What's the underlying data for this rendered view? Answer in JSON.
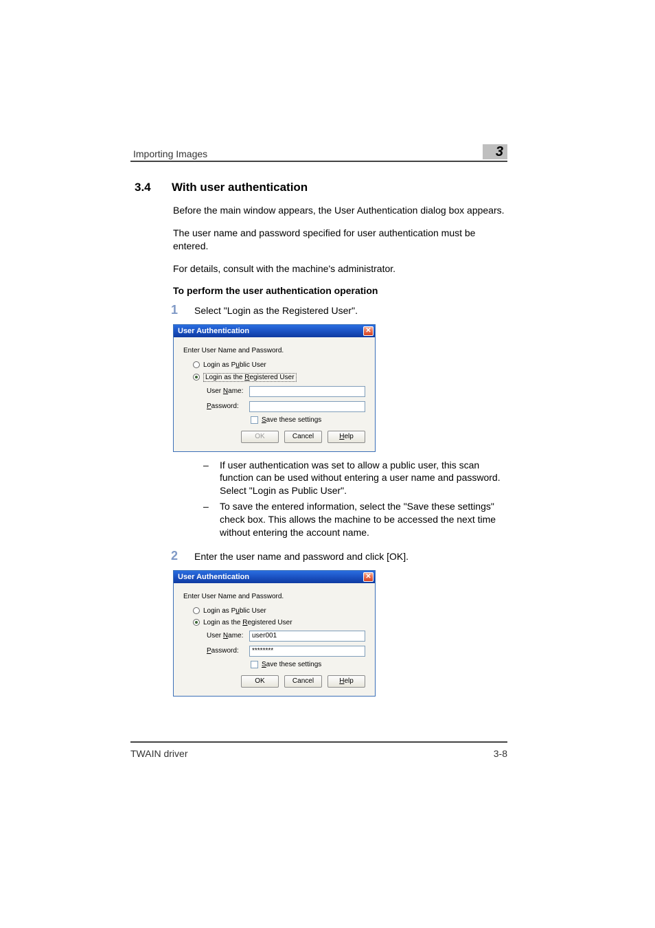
{
  "header": {
    "left": "Importing Images",
    "chapter_number": "3"
  },
  "section": {
    "number": "3.4",
    "title": "With user authentication"
  },
  "paragraphs": {
    "intro1": "Before the main window appears, the User Authentication dialog box appears.",
    "intro2": "The user name and password specified for user authentication must be entered.",
    "intro3": "For details, consult with the machine's administrator.",
    "subheading": "To perform the user authentication operation"
  },
  "steps": {
    "step1_num": "1",
    "step1_text": "Select \"Login as the Registered User\".",
    "bullet1": "If user authentication was set to allow a public user, this scan function can be used without entering a user name and password. Select \"Login as Public User\".",
    "bullet2": "To save the entered information, select the \"Save these settings\" check box. This allows the machine to be accessed the next time without entering the account name.",
    "step2_num": "2",
    "step2_text": "Enter the user name and password and click [OK]."
  },
  "dialog_common": {
    "title": "User Authentication",
    "caption": "Enter User Name and Password.",
    "radio_public_pre": "Login as P",
    "radio_public_u": "u",
    "radio_public_post": "blic User",
    "radio_reg_pre": "Login as the ",
    "radio_reg_u": "R",
    "radio_reg_post": "egistered User",
    "username_label_pre": "User ",
    "username_label_u": "N",
    "username_label_post": "ame:",
    "password_label_u": "P",
    "password_label_post": "assword:",
    "save_u": "S",
    "save_post": "ave these settings",
    "ok": "OK",
    "cancel": "Cancel",
    "help_u": "H",
    "help_post": "elp"
  },
  "dialog1": {
    "username_value": "",
    "password_value": "",
    "ok_enabled": false
  },
  "dialog2": {
    "username_value": "user001",
    "password_value": "********",
    "ok_enabled": true
  },
  "footer": {
    "left": "TWAIN driver",
    "right": "3-8"
  }
}
